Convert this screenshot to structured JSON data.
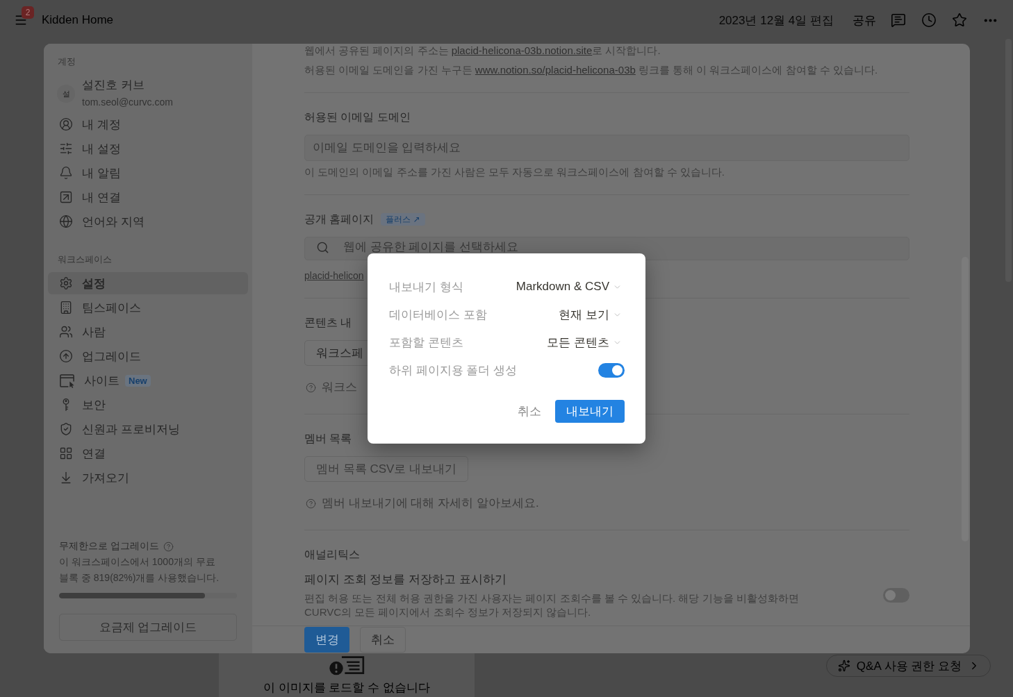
{
  "top_bar": {
    "badge": "2",
    "title": "Kidden Home",
    "edited": "2023년 12월 4일 편집",
    "share": "공유"
  },
  "settings": {
    "sidebar": {
      "account_title": "계정",
      "user": {
        "initial": "설",
        "name": "설진호 커브",
        "email": "tom.seol@curvc.com"
      },
      "account_items": [
        {
          "label": "내 계정",
          "selected": false
        },
        {
          "label": "내 설정",
          "selected": false
        },
        {
          "label": "내 알림",
          "selected": false
        },
        {
          "label": "내 연결",
          "selected": false
        },
        {
          "label": "언어와 지역",
          "selected": false
        }
      ],
      "workspace_title": "워크스페이스",
      "workspace_items": [
        {
          "label": "설정",
          "selected": true
        },
        {
          "label": "팀스페이스",
          "selected": false
        },
        {
          "label": "사람",
          "selected": false
        },
        {
          "label": "업그레이드",
          "selected": false
        },
        {
          "label": "사이트",
          "badge": "New",
          "selected": false
        },
        {
          "label": "보안",
          "selected": false
        },
        {
          "label": "신원과 프로비저닝",
          "selected": false
        },
        {
          "label": "연결",
          "selected": false
        },
        {
          "label": "가져오기",
          "selected": false
        }
      ],
      "usage": {
        "title": "무제한으로 업그레이드",
        "text": "이 워크스페이스에서 1000개의 무료 블록 중 819(82%)개를 사용했습니다.",
        "level": 0.82,
        "button": "요금제 업그레이드"
      }
    },
    "content": {
      "intro": [
        {
          "before": "웹에서 공유된 페이지의 주소는 ",
          "link": "placid-helicona-03b.notion.site",
          "after": "로 시작합니다."
        },
        {
          "before": "허용된 이메일 도메인을 가진 누구든 ",
          "link": "www.notion.so/placid-helicona-03b",
          "after": " 링크를 통해 이 워크스페이스에 참여할 수 있습니다."
        }
      ],
      "sections": [
        {
          "kind": "input",
          "title": "허용된 이메일 도메인",
          "placeholder": "이메일 도메인을 입력하세요",
          "note": "이 도메인의 이메일 주소를 가진 사람은 모두 자동으로 워크스페이스에 참여할 수 있습니다."
        },
        {
          "kind": "search",
          "title": "공개 홈페이지",
          "badge": "플러스 ↗",
          "placeholder": "웹에 공유한 페이지를 선택하세요",
          "link": "placid-helicon"
        },
        {
          "kind": "button",
          "title": "콘텐츠 내",
          "button": "워크스페",
          "disabled": false,
          "help": "워크스"
        },
        {
          "kind": "button",
          "title": "멤버 목록",
          "button": "멤버 목록 CSV로 내보내기",
          "disabled": true,
          "help": "멤버 내보내기에 대해 자세히 알아보세요."
        },
        {
          "kind": "toggle",
          "title": "애널리틱스",
          "setting": "페이지 조회 정보를 저장하고 표시하기",
          "description": "편집 허용 또는 전체 허용 권한을 가진 사용자는 페이지 조회수를 볼 수 있습니다. 해당 기능을 비활성화하면 CURVC의 모든 페이지에서 조회수 정보가 저장되지 않습니다.",
          "on": false
        }
      ]
    },
    "actions": {
      "save": "변경",
      "cancel": "취소"
    }
  },
  "export_dialog": {
    "options": [
      {
        "kind": "select",
        "label": "내보내기 형식",
        "value": "Markdown & CSV"
      },
      {
        "kind": "select",
        "label": "데이터베이스 포함",
        "value": "현재 보기"
      },
      {
        "kind": "select",
        "label": "포함할 콘텐츠",
        "value": "모든 콘텐츠"
      },
      {
        "kind": "toggle",
        "label": "하위 페이지용 폴더 생성",
        "on": true
      }
    ],
    "cancel": "취소",
    "confirm": "내보내기"
  },
  "page": {
    "image_error": "이 이미지를 로드할 수 없습니다",
    "qa_button": "Q&A 사용 권한 요청"
  }
}
